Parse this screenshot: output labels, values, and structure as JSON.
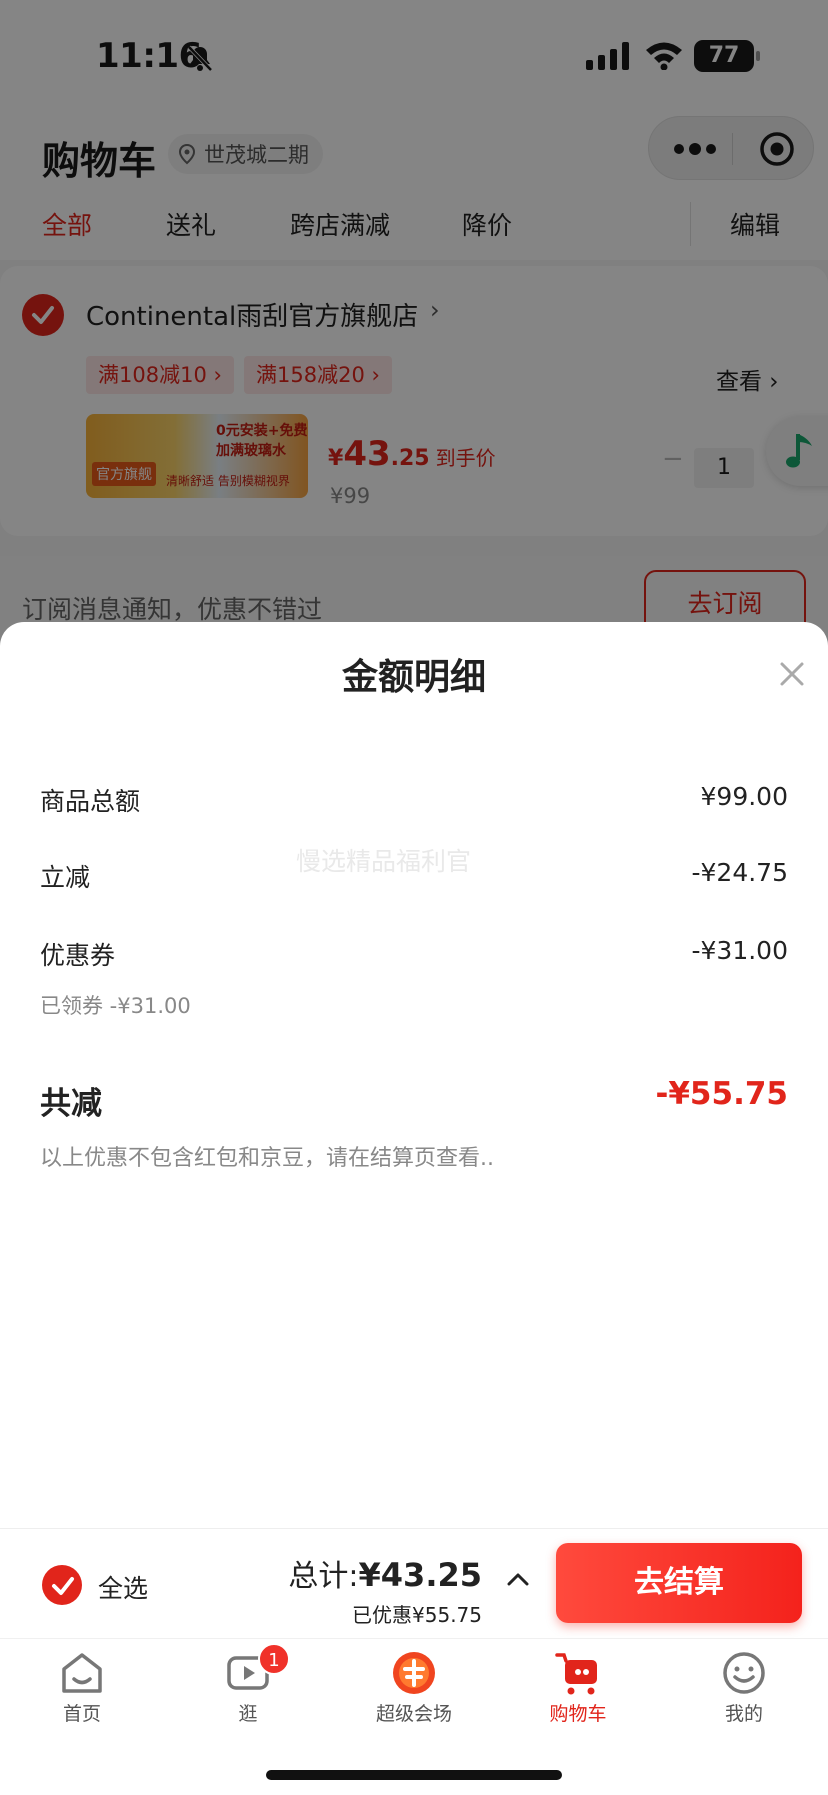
{
  "status_bar": {
    "time": "11:16",
    "battery": "77"
  },
  "header": {
    "title": "购物车",
    "location": "世茂城二期",
    "tabs": [
      "全部",
      "送礼",
      "跨店满减",
      "降价",
      "编辑"
    ]
  },
  "store": {
    "name": "Continental雨刮官方旗舰店",
    "chevron": "›",
    "promos": [
      "满108减10 ›",
      "满158减20 ›"
    ],
    "view_label": "查看 ›",
    "product": {
      "thumb_badge": "官方旗舰",
      "thumb_text": "0元安装+免费加满玻璃水",
      "thumb_text2": "清晰舒适 告别模糊视界",
      "price_yen": "¥",
      "price_int": "43",
      "price_dec": ".25",
      "price_note": "到手价",
      "original_price": "¥99",
      "qty_minus": "−",
      "quantity": "1"
    }
  },
  "subscribe": {
    "text": "订阅消息通知，优惠不错过",
    "button": "去订阅"
  },
  "sheet": {
    "title": "金额明细",
    "watermark": "慢选精品福利官",
    "rows": [
      {
        "label": "商品总额",
        "value": "¥99.00"
      },
      {
        "label": "立减",
        "value": "-¥24.75"
      },
      {
        "label": "优惠券",
        "value": "-¥31.00",
        "sub": "已领券 -¥31.00"
      }
    ],
    "total_label": "共减",
    "total_value": "-¥55.75",
    "note": "以上优惠不包含红包和京豆，请在结算页查看.."
  },
  "checkout": {
    "select_all": "全选",
    "sum_prefix": "总计:",
    "sum_amount": "¥43.25",
    "saved": "已优惠¥55.75",
    "button": "去结算"
  },
  "tabbar": {
    "items": [
      {
        "label": "首页",
        "icon": "home-icon"
      },
      {
        "label": "逛",
        "icon": "video-icon",
        "badge": "1"
      },
      {
        "label": "超级会场",
        "icon": "super-venue-icon"
      },
      {
        "label": "购物车",
        "icon": "cart-icon",
        "active": true
      },
      {
        "label": "我的",
        "icon": "profile-icon"
      }
    ]
  },
  "colors": {
    "accent": "#e1251b",
    "overlay": "rgba(0,0,0,0.48)"
  }
}
